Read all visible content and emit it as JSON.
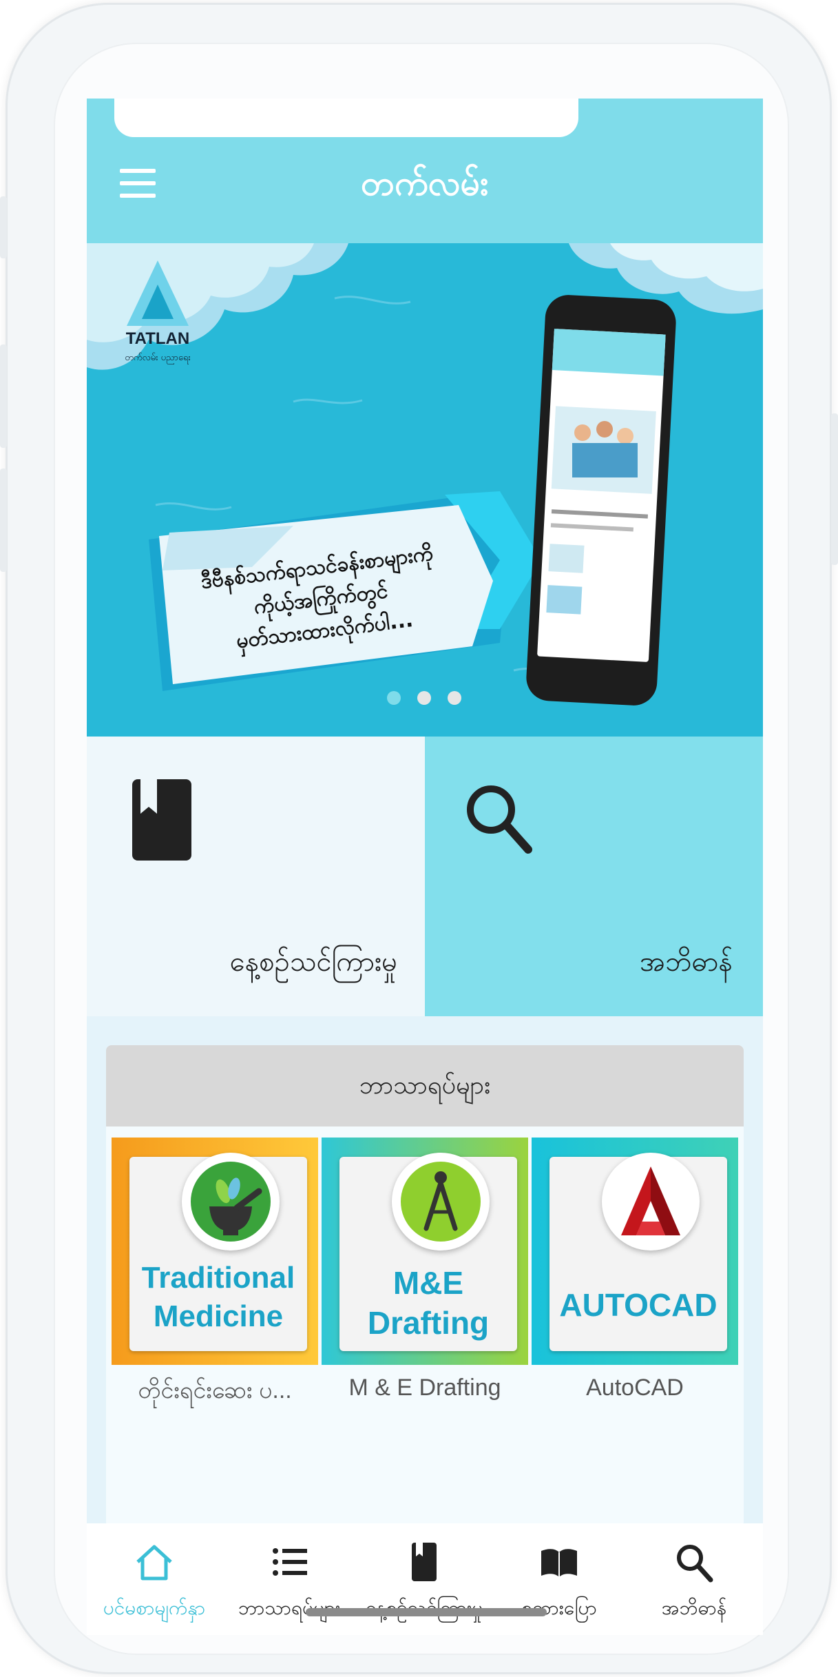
{
  "header": {
    "title": "တက်လမ်း"
  },
  "banner": {
    "logo_text": "TATLAN",
    "logo_subtext": "တက်လမ်း ပညာရေး",
    "slogan_lines": [
      "ဒီဗီနစ်သက်ရာသင်ခန်းစာများကို",
      "ကိုယ့်အကြိုက်တွင်",
      "မှတ်သားထားလိုက်ပါ..."
    ],
    "active_dot": 0,
    "dot_count": 3
  },
  "tiles": {
    "left_label": "နေ့စဉ်သင်ကြားမှု",
    "right_label": "အဘိဓာန်"
  },
  "courses": {
    "header": "ဘာသာရပ်များ",
    "items": [
      {
        "line1": "Traditional",
        "line2": "Medicine",
        "caption": "တိုင်းရင်းဆေး ပ...",
        "band_color": "#f7a21b"
      },
      {
        "line1": "M&E",
        "line2": "Drafting",
        "caption": "M & E Drafting",
        "band_color": "#3cc6cf"
      },
      {
        "line1": "AUTOCAD",
        "line2": "",
        "caption": "AutoCAD",
        "band_color": "#20c3d8"
      }
    ]
  },
  "bottom_nav": {
    "active_color": "#3bbfd6",
    "items": [
      {
        "label": "ပင်မစာမျက်နှာ",
        "icon": "home-icon",
        "active": true
      },
      {
        "label": "ဘာသာရပ်များ",
        "icon": "list-icon",
        "active": false
      },
      {
        "label": "နေ့စဉ်သင်ကြားမှု",
        "icon": "bookmark-book-icon",
        "active": false
      },
      {
        "label": "စကားပြော",
        "icon": "open-book-icon",
        "active": false
      },
      {
        "label": "အဘိဓာန်",
        "icon": "search-icon",
        "active": false
      }
    ]
  }
}
